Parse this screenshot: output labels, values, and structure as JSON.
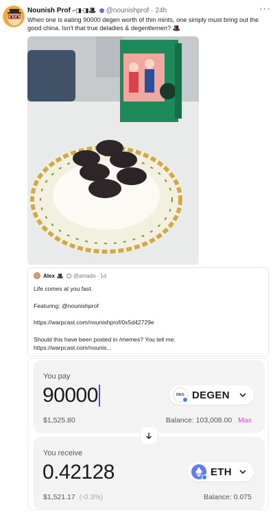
{
  "post": {
    "author": {
      "display_name": "Nounish Prof",
      "name_glyphs": "⌐◨-◨🎩",
      "handle": "@nounishprof",
      "time": "24h"
    },
    "more_label": "···",
    "text": "When one is eating 90000 degen worth of thin mints, one simply must bring out the good china. Isn't that true deladies & degentlemen? 🎩",
    "photo_icon": "cookie-plate-photo"
  },
  "quote": {
    "author": {
      "display_name": "Alex",
      "hat": "🎩",
      "handle": "@amado",
      "time": "1d"
    },
    "lines": [
      "Life comes at you fast.",
      "Featuring: @nounishprof",
      "https://warpcast.com/nounishprof/0x5d42729e",
      "Should this have been posted in /memes? You tell me.",
      "https://warpcast.com/nounis..."
    ]
  },
  "swap": {
    "pay": {
      "label": "You pay",
      "amount": "90000",
      "token_icon_text": "DEG",
      "token": "DEGEN",
      "fiat": "$1,525.80",
      "balance": "Balance: 103,008.00",
      "max_label": "Max"
    },
    "receive": {
      "label": "You receive",
      "amount": "0.42128",
      "token": "ETH",
      "fiat": "$1,521.17",
      "fiat_delta": "(-0.3%)",
      "balance": "Balance: 0.075"
    },
    "colors": {
      "caret": "#4c4cf0",
      "max": "#e44bd6",
      "eth": "#627eea",
      "panel_bg": "#f3f3f3"
    }
  }
}
